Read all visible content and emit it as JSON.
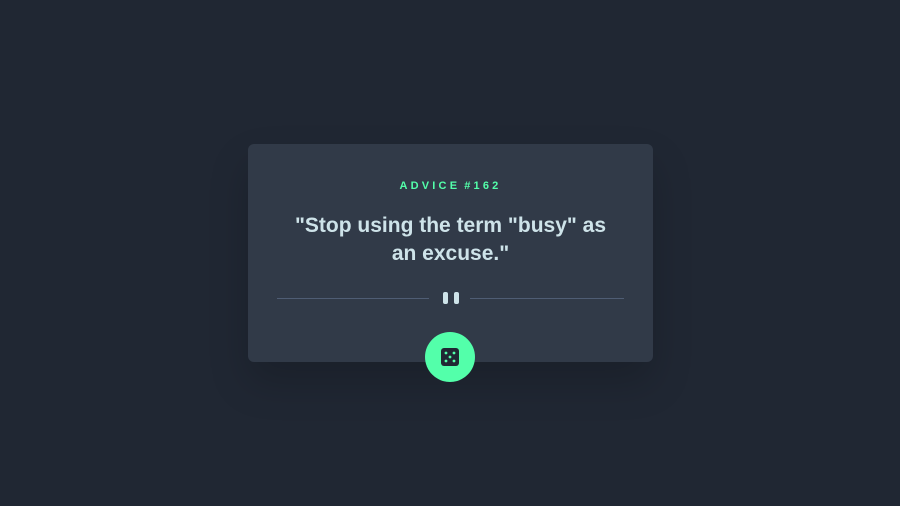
{
  "advice": {
    "label": "ADVICE",
    "number": "#162",
    "quote": "\"Stop using the term \"busy\" as an excuse.\""
  },
  "icons": {
    "divider": "pause-icon",
    "button": "dice-icon"
  },
  "colors": {
    "background": "#202733",
    "card": "#313a48",
    "accent": "#53ffaa",
    "text": "#cee3e9",
    "divider": "#4f5d74"
  }
}
